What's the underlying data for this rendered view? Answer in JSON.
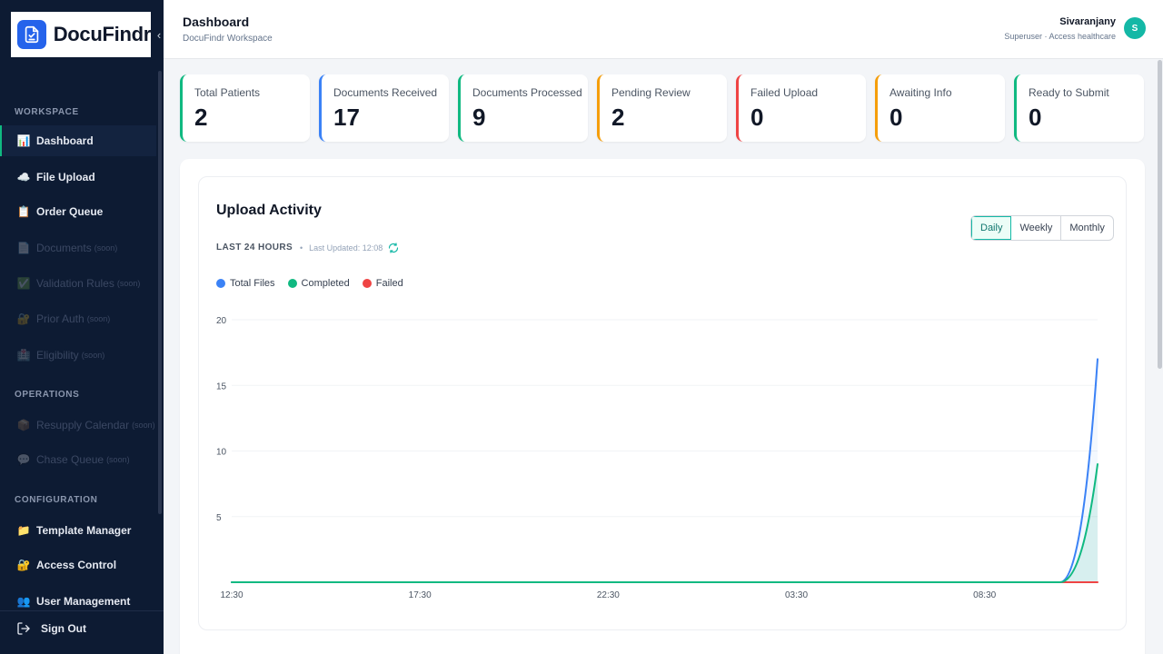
{
  "app": {
    "name": "DocuFindr"
  },
  "sidebar": {
    "sections": [
      {
        "label": "WORKSPACE"
      },
      {
        "label": "OPERATIONS"
      },
      {
        "label": "CONFIGURATION"
      }
    ],
    "items": [
      {
        "label": "Dashboard",
        "icon": "bar-chart-icon",
        "glyph": "📊",
        "active": true
      },
      {
        "label": "File Upload",
        "icon": "cloud-icon",
        "glyph": "☁️"
      },
      {
        "label": "Order Queue",
        "icon": "clipboard-icon",
        "glyph": "📋"
      },
      {
        "label": "Documents",
        "soon": "(soon)",
        "icon": "document-icon",
        "glyph": "📄",
        "disabled": true
      },
      {
        "label": "Validation Rules",
        "soon": "(soon)",
        "icon": "check-icon",
        "glyph": "✅",
        "disabled": true
      },
      {
        "label": "Prior Auth",
        "soon": "(soon)",
        "icon": "lock-icon",
        "glyph": "🔐",
        "disabled": true
      },
      {
        "label": "Eligibility",
        "soon": "(soon)",
        "icon": "hospital-icon",
        "glyph": "🏥",
        "disabled": true
      },
      {
        "label": "Resupply Calendar",
        "soon": "(soon)",
        "icon": "box-icon",
        "glyph": "📦",
        "disabled": true
      },
      {
        "label": "Chase Queue",
        "soon": "(soon)",
        "icon": "chat-icon",
        "glyph": "💬",
        "disabled": true
      },
      {
        "label": "Template Manager",
        "icon": "folder-icon",
        "glyph": "📁"
      },
      {
        "label": "Access Control",
        "icon": "lock-key-icon",
        "glyph": "🔐"
      },
      {
        "label": "User Management",
        "icon": "users-icon",
        "glyph": "👥"
      }
    ],
    "signout": "Sign Out"
  },
  "header": {
    "title": "Dashboard",
    "subtitle": "DocuFindr Workspace",
    "user_name": "Sivaranjany",
    "user_role": "Superuser · Access healthcare",
    "avatar_initial": "S"
  },
  "stats": [
    {
      "label": "Total Patients",
      "value": "2",
      "color": "#10b981"
    },
    {
      "label": "Documents Received",
      "value": "17",
      "color": "#3b82f6"
    },
    {
      "label": "Documents Processed",
      "value": "9",
      "color": "#10b981"
    },
    {
      "label": "Pending Review",
      "value": "2",
      "color": "#f59e0b"
    },
    {
      "label": "Failed Upload",
      "value": "0",
      "color": "#ef4444"
    },
    {
      "label": "Awaiting Info",
      "value": "0",
      "color": "#f59e0b"
    },
    {
      "label": "Ready to Submit",
      "value": "0",
      "color": "#10b981"
    }
  ],
  "activity": {
    "title": "Upload Activity",
    "range_label": "LAST 24 HOURS",
    "updated_label": "Last Updated: 12:08",
    "periods": [
      "Daily",
      "Weekly",
      "Monthly"
    ],
    "active_period": "Daily"
  },
  "chart_data": {
    "type": "line",
    "title": "Upload Activity",
    "x_ticks": [
      "12:30",
      "17:30",
      "22:30",
      "03:30",
      "08:30"
    ],
    "y_ticks": [
      5,
      10,
      15,
      20
    ],
    "ylim": [
      0,
      20
    ],
    "x": [
      "12:30",
      "17:30",
      "22:30",
      "03:30",
      "08:30",
      "10:30",
      "11:30"
    ],
    "series": [
      {
        "name": "Total Files",
        "color": "#3b82f6",
        "values": [
          0,
          0,
          0,
          0,
          0,
          0,
          17
        ]
      },
      {
        "name": "Completed",
        "color": "#10b981",
        "values": [
          0,
          0,
          0,
          0,
          0,
          0,
          9
        ]
      },
      {
        "name": "Failed",
        "color": "#ef4444",
        "values": [
          0,
          0,
          0,
          0,
          0,
          0,
          0
        ]
      }
    ],
    "grid": true,
    "legend": "top-left"
  }
}
